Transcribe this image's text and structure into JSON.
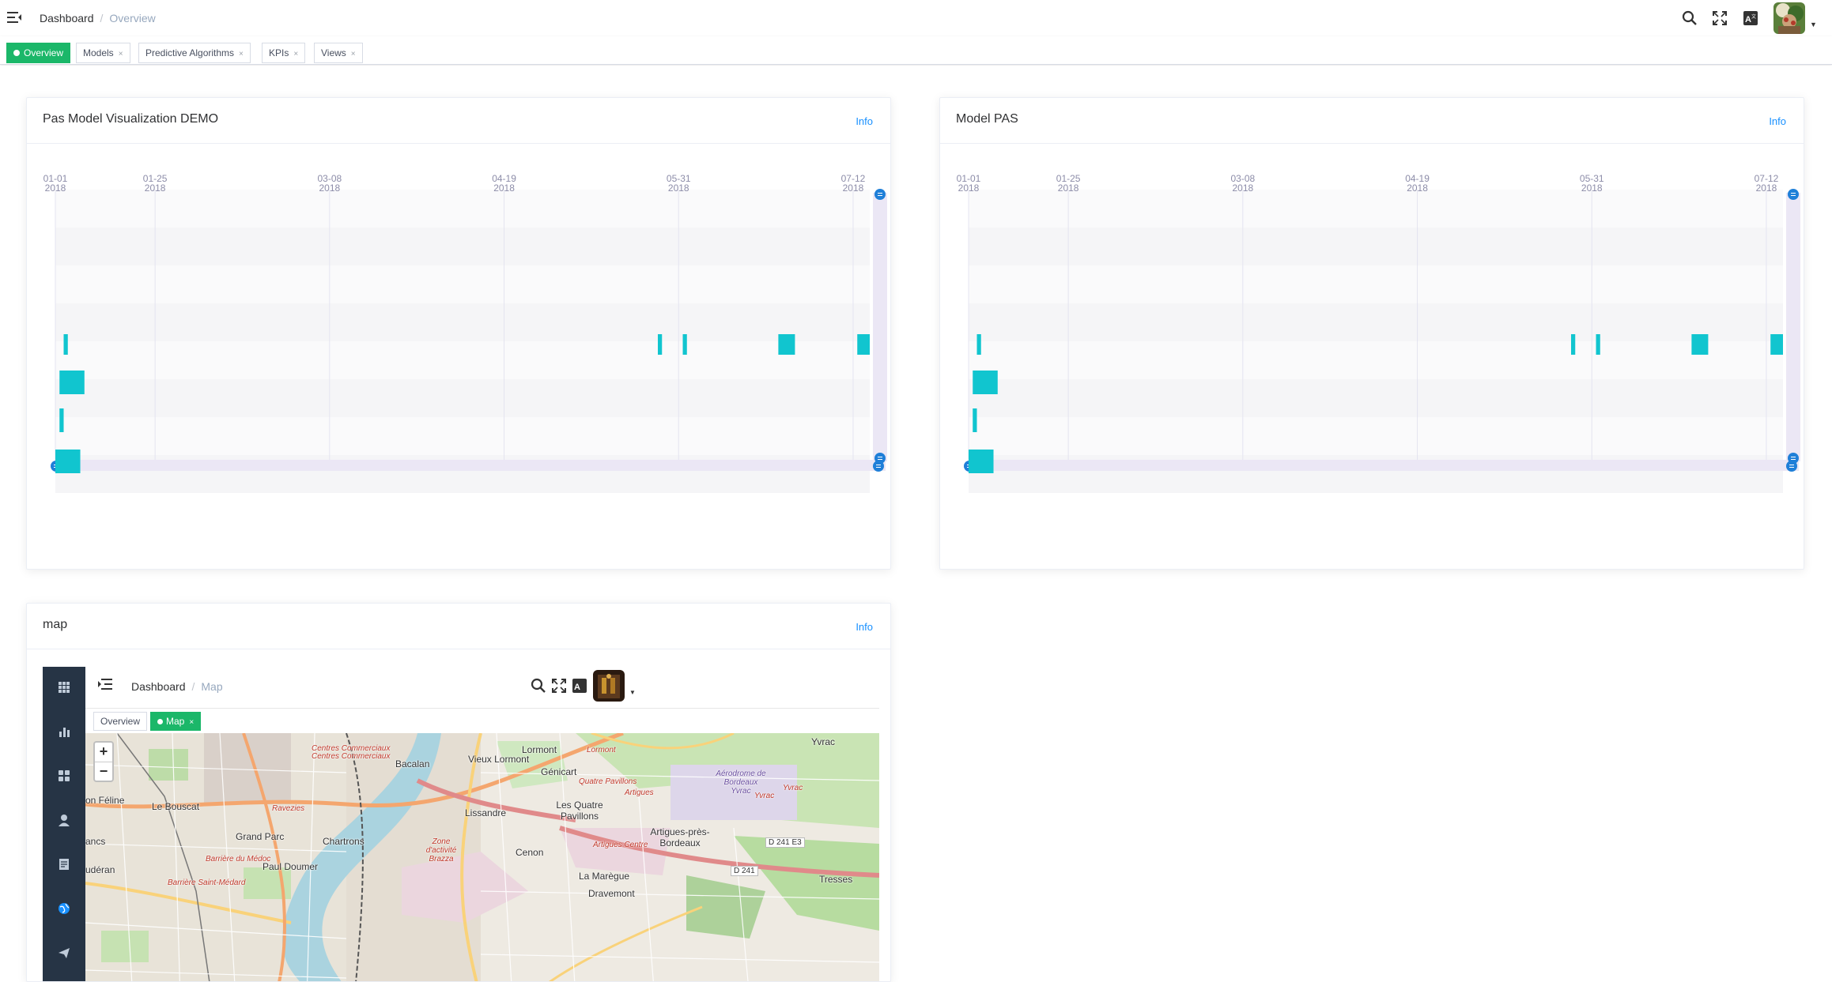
{
  "header": {
    "breadcrumb": [
      "Dashboard",
      "Overview"
    ],
    "icons": [
      "menu-icon",
      "search-icon",
      "fullscreen-icon",
      "translate-icon",
      "avatar"
    ]
  },
  "tags": [
    {
      "label": "Overview",
      "active": true
    },
    {
      "label": "Models",
      "active": false
    },
    {
      "label": "Predictive Algorithms",
      "active": false
    },
    {
      "label": "KPIs",
      "active": false
    },
    {
      "label": "Views",
      "active": false
    }
  ],
  "cards": {
    "demo": {
      "title": "Pas Model Visualization DEMO",
      "info": "Info"
    },
    "pas": {
      "title": "Model PAS",
      "info": "Info"
    },
    "map": {
      "title": "map",
      "info": "Info"
    }
  },
  "chart_data": [
    {
      "type": "timeline",
      "title": "Pas Model Visualization DEMO",
      "x_ticks": [
        {
          "date": "01-01",
          "year": "2018"
        },
        {
          "date": "01-25",
          "year": "2018"
        },
        {
          "date": "03-08",
          "year": "2018"
        },
        {
          "date": "04-19",
          "year": "2018"
        },
        {
          "date": "05-31",
          "year": "2018"
        },
        {
          "date": "07-12",
          "year": "2018"
        }
      ],
      "x_range": [
        "2018-01-01",
        "2018-07-16"
      ],
      "rows": 8,
      "events": [
        {
          "row": 5,
          "start": "2018-01-03",
          "end": "2018-01-04"
        },
        {
          "row": 5,
          "start": "2018-05-26",
          "end": "2018-05-27"
        },
        {
          "row": 5,
          "start": "2018-06-01",
          "end": "2018-06-02"
        },
        {
          "row": 5,
          "start": "2018-06-24",
          "end": "2018-06-28"
        },
        {
          "row": 5,
          "start": "2018-07-13",
          "end": "2018-07-16"
        },
        {
          "row": 6,
          "start": "2018-01-02",
          "end": "2018-01-08"
        },
        {
          "row": 7,
          "start": "2018-01-02",
          "end": "2018-01-03"
        },
        {
          "row": 8,
          "start": "2018-01-01",
          "end": "2018-01-07"
        }
      ]
    },
    {
      "type": "timeline",
      "title": "Model PAS",
      "x_ticks": [
        {
          "date": "01-01",
          "year": "2018"
        },
        {
          "date": "01-25",
          "year": "2018"
        },
        {
          "date": "03-08",
          "year": "2018"
        },
        {
          "date": "04-19",
          "year": "2018"
        },
        {
          "date": "05-31",
          "year": "2018"
        },
        {
          "date": "07-12",
          "year": "2018"
        }
      ],
      "x_range": [
        "2018-01-01",
        "2018-07-16"
      ],
      "rows": 8,
      "events": [
        {
          "row": 5,
          "start": "2018-01-03",
          "end": "2018-01-04"
        },
        {
          "row": 5,
          "start": "2018-05-26",
          "end": "2018-05-27"
        },
        {
          "row": 5,
          "start": "2018-06-01",
          "end": "2018-06-02"
        },
        {
          "row": 5,
          "start": "2018-06-24",
          "end": "2018-06-28"
        },
        {
          "row": 5,
          "start": "2018-07-13",
          "end": "2018-07-16"
        },
        {
          "row": 6,
          "start": "2018-01-02",
          "end": "2018-01-08"
        },
        {
          "row": 7,
          "start": "2018-01-02",
          "end": "2018-01-03"
        },
        {
          "row": 8,
          "start": "2018-01-01",
          "end": "2018-01-07"
        }
      ]
    }
  ],
  "map_app": {
    "breadcrumb": [
      "Dashboard",
      "Map"
    ],
    "tags": [
      {
        "label": "Overview",
        "active": false
      },
      {
        "label": "Map",
        "active": true
      }
    ],
    "sidebar_icons": [
      "grid-icon",
      "bar-chart-icon",
      "apps-icon",
      "user-icon",
      "document-icon",
      "globe-icon",
      "send-icon"
    ],
    "zoom": {
      "in": "+",
      "out": "−"
    },
    "labels": [
      {
        "text": "Yvrac",
        "style": "normal"
      },
      {
        "text": "Lormont",
        "style": "normal"
      },
      {
        "text": "Lormont",
        "style": "red"
      },
      {
        "text": "Centres Commerciaux",
        "style": "red"
      },
      {
        "text": "Centres Commerciaux",
        "style": "red"
      },
      {
        "text": "Bacalan",
        "style": "normal"
      },
      {
        "text": "Vieux Lormont",
        "style": "normal"
      },
      {
        "text": "Génicart",
        "style": "normal"
      },
      {
        "text": "Quatre Pavillons",
        "style": "red"
      },
      {
        "text": "Artigues",
        "style": "red"
      },
      {
        "text": "Aérodrome de Bordeaux Yvrac",
        "style": "purple"
      },
      {
        "text": "Yvrac",
        "style": "red"
      },
      {
        "text": "Yvrac",
        "style": "red"
      },
      {
        "text": "on Féline",
        "style": "normal"
      },
      {
        "text": "Le Bouscat",
        "style": "normal"
      },
      {
        "text": "Ravezies",
        "style": "red"
      },
      {
        "text": "Lissandre",
        "style": "normal"
      },
      {
        "text": "Les Quatre Pavillons",
        "style": "normal"
      },
      {
        "text": "Artigues-près-Bordeaux",
        "style": "normal"
      },
      {
        "text": "Grand Parc",
        "style": "normal"
      },
      {
        "text": "Chartrons",
        "style": "normal"
      },
      {
        "text": "Zone d'activité Brazza",
        "style": "red"
      },
      {
        "text": "Artigues Centre",
        "style": "red"
      },
      {
        "text": "D 241 E3",
        "style": "road"
      },
      {
        "text": "ancs",
        "style": "normal"
      },
      {
        "text": "Cenon",
        "style": "normal"
      },
      {
        "text": "Barrière du Médoc",
        "style": "red"
      },
      {
        "text": "Paul Doumer",
        "style": "normal"
      },
      {
        "text": "D 241",
        "style": "road"
      },
      {
        "text": "udéran",
        "style": "normal"
      },
      {
        "text": "La Marègue",
        "style": "normal"
      },
      {
        "text": "Barrière Saint-Médard",
        "style": "red"
      },
      {
        "text": "Tresses",
        "style": "normal"
      },
      {
        "text": "Dravemont",
        "style": "normal"
      }
    ]
  },
  "colors": {
    "accent_green": "#1bb769",
    "bar_cyan": "#11c5cf",
    "link_blue": "#1890ff",
    "sidebar_dark": "#263445",
    "handle_blue": "#1f7fd8"
  }
}
